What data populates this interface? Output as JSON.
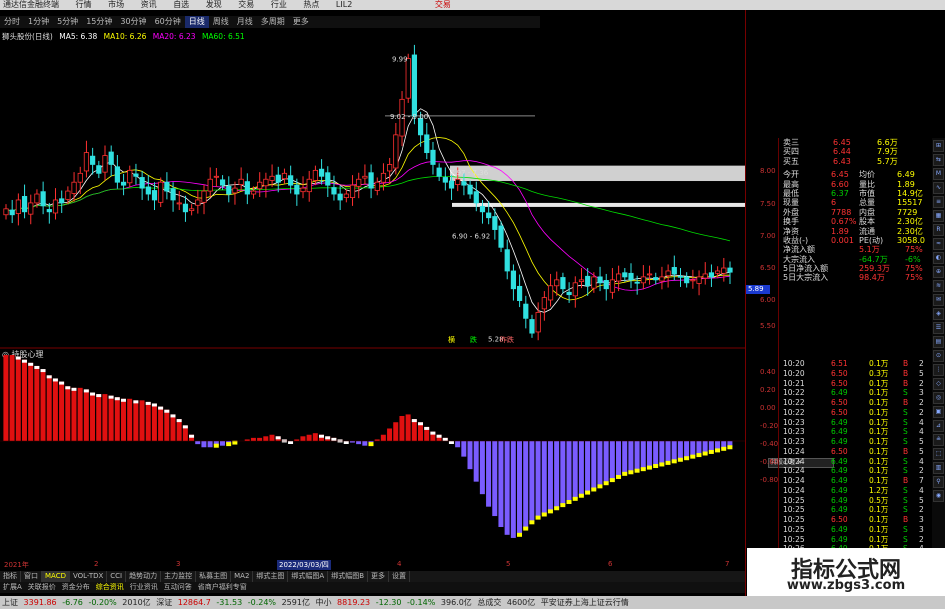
{
  "titlebar": {
    "app": "通达信金融终端",
    "menus": [
      "行情",
      "市场",
      "资讯",
      "自选",
      "发现",
      "交易",
      "行业",
      "热点",
      "LIL2"
    ],
    "trade": "交易"
  },
  "periods": [
    "分时",
    "1分钟",
    "5分钟",
    "15分钟",
    "30分钟",
    "60分钟",
    "日线",
    "周线",
    "月线",
    "多周期",
    "更多"
  ],
  "active_period": "日线",
  "legend": {
    "stock": "狮头股份(日线)",
    "ma5": "MA5: 6.38",
    "ma10": "MA10: 6.26",
    "ma20": "MA20: 6.23",
    "ma60": "MA60: 6.51",
    "colors": {
      "ma5": "#ffffff",
      "ma10": "#ffff00",
      "ma20": "#ff00ff",
      "ma60": "#00ff00"
    }
  },
  "annotations": {
    "high": "9.99",
    "range1": "9.02 - 9.00",
    "range2": "7.97 - 7.36",
    "range3": "6.90 - 6.92",
    "low": "5.28",
    "tag1": "横",
    "tag2": "跌",
    "tag3": "昨跌"
  },
  "chart_data": [
    {
      "type": "candlestick",
      "title": "狮头股份(日线)",
      "high_label": 9.99,
      "low_label": 5.28,
      "yaxis_ticks": [
        "8.00",
        "7.50",
        "7.00",
        "6.50",
        "6.00",
        "5.50"
      ],
      "series": [
        {
          "name": "MA5",
          "value": 6.38
        },
        {
          "name": "MA10",
          "value": 6.26
        },
        {
          "name": "MA20",
          "value": 6.23
        },
        {
          "name": "MA60",
          "value": 6.51
        }
      ]
    },
    {
      "type": "bar",
      "title": "持股心理",
      "yaxis_ticks": [
        "0.40",
        "0.20",
        "0.00",
        "-0.20",
        "-0.40",
        "-0.60",
        "-0.80"
      ]
    }
  ],
  "sub_title": "持股心理",
  "dates": {
    "d1": "2021年",
    "d2": "2",
    "d3": "3",
    "selected": "2022/03/03/四",
    "d5": "4",
    "d6": "5",
    "d7": "6",
    "d8": "7"
  },
  "tabs": [
    "指标",
    "窗口",
    "MACD",
    "VOL-TDX",
    "CCI",
    "趋势动力",
    "主力监控",
    "私募主图",
    "MA2",
    "绑式主图",
    "绑式幅图A",
    "绑式幅图B",
    "更多",
    "设置"
  ],
  "tabs2": [
    "扩展A",
    "关联报价",
    "资金分布",
    "综合资讯",
    "行业资讯",
    "互动问答",
    "省商户福利专窗"
  ],
  "quote": {
    "rows": [
      {
        "l": "卖三",
        "v": "6.45",
        "q": "6.6万"
      },
      {
        "l": "买四",
        "v": "6.44",
        "q": "7.9万"
      },
      {
        "l": "买五",
        "v": "6.43",
        "q": "5.7万"
      }
    ],
    "stats": [
      {
        "a": "今开",
        "av": "6.45",
        "b": "均价",
        "bv": "6.49"
      },
      {
        "a": "最高",
        "av": "6.60",
        "b": "量比",
        "bv": "1.89"
      },
      {
        "a": "最低",
        "av": "6.37",
        "b": "市值",
        "bv": "14.9亿"
      },
      {
        "a": "现量",
        "av": "6",
        "b": "总量",
        "bv": "15517"
      },
      {
        "a": "外盘",
        "av": "7788",
        "b": "内盘",
        "bv": "7729"
      },
      {
        "a": "换手",
        "av": "0.67%",
        "b": "股本",
        "bv": "2.30亿"
      },
      {
        "a": "净资",
        "av": "1.89",
        "b": "流通",
        "bv": "2.30亿"
      },
      {
        "a": "收益(-)",
        "av": "0.001",
        "b": "PE(动)",
        "bv": "3058.0"
      }
    ],
    "flows": [
      {
        "l": "净流入额",
        "v": "5.1万",
        "u": "75%",
        "cls": "r"
      },
      {
        "l": "大宗流入",
        "v": "-64.7万",
        "u": "-6%",
        "cls": "g"
      },
      {
        "l": "5日净流入额",
        "v": "259.3万",
        "u": "75%",
        "cls": "r"
      },
      {
        "l": "5日大宗流入",
        "v": "98.4万",
        "u": "75%",
        "cls": "r"
      }
    ]
  },
  "trades": [
    {
      "t": "10:20",
      "p": "6.51",
      "v": "0.1万",
      "d": "B",
      "n": "2"
    },
    {
      "t": "10:20",
      "p": "6.50",
      "v": "0.3万",
      "d": "B",
      "n": "5"
    },
    {
      "t": "10:21",
      "p": "6.50",
      "v": "0.1万",
      "d": "B",
      "n": "2"
    },
    {
      "t": "10:22",
      "p": "6.49",
      "v": "0.1万",
      "d": "S",
      "n": "3"
    },
    {
      "t": "10:22",
      "p": "6.50",
      "v": "0.1万",
      "d": "B",
      "n": "2"
    },
    {
      "t": "10:22",
      "p": "6.50",
      "v": "0.1万",
      "d": "S",
      "n": "2"
    },
    {
      "t": "10:23",
      "p": "6.49",
      "v": "0.1万",
      "d": "S",
      "n": "4"
    },
    {
      "t": "10:23",
      "p": "6.49",
      "v": "0.1万",
      "d": "S",
      "n": "4"
    },
    {
      "t": "10:23",
      "p": "6.49",
      "v": "0.1万",
      "d": "S",
      "n": "5"
    },
    {
      "t": "10:24",
      "p": "6.50",
      "v": "0.1万",
      "d": "B",
      "n": "5"
    },
    {
      "t": "10:24",
      "p": "6.49",
      "v": "0.1万",
      "d": "S",
      "n": "4"
    },
    {
      "t": "10:24",
      "p": "6.49",
      "v": "0.1万",
      "d": "S",
      "n": "2"
    },
    {
      "t": "10:24",
      "p": "6.49",
      "v": "0.1万",
      "d": "B",
      "n": "7"
    },
    {
      "t": "10:24",
      "p": "6.49",
      "v": "1.2万",
      "d": "S",
      "n": "4"
    },
    {
      "t": "10:25",
      "p": "6.49",
      "v": "0.5万",
      "d": "S",
      "n": "5"
    },
    {
      "t": "10:25",
      "p": "6.49",
      "v": "0.1万",
      "d": "S",
      "n": "2"
    },
    {
      "t": "10:25",
      "p": "6.50",
      "v": "0.1万",
      "d": "B",
      "n": "3"
    },
    {
      "t": "10:25",
      "p": "6.49",
      "v": "0.1万",
      "d": "S",
      "n": "3"
    },
    {
      "t": "10:25",
      "p": "6.49",
      "v": "0.1万",
      "d": "S",
      "n": "2"
    },
    {
      "t": "10:26",
      "p": "6.49",
      "v": "0.1万",
      "d": "S",
      "n": "4"
    },
    {
      "t": "10:26",
      "p": "6.50",
      "v": "0.1万",
      "d": "B",
      "n": "3"
    }
  ],
  "pricebox": "5.89",
  "minibox": "持股心理 ✕",
  "status": {
    "sh_label": "上证",
    "sh": "3391.86",
    "sh_chg": "-6.76",
    "sh_pct": "-0.20%",
    "sh_amt": "2010亿",
    "sz_label": "深证",
    "sz": "12864.7",
    "sz_chg": "-31.53",
    "sz_pct": "-0.24%",
    "sz_amt": "2591亿",
    "zx_label": "中小",
    "zx": "8819.23",
    "zx_chg": "-12.30",
    "zx_pct": "-0.14%",
    "zx_amt": "396.0亿",
    "tot_label": "总成交",
    "tot": "4600亿",
    "broker": "平安证券上海上证云行情"
  },
  "watermark": {
    "cn": "指标公式网",
    "url": "www.zbgs3.com"
  }
}
